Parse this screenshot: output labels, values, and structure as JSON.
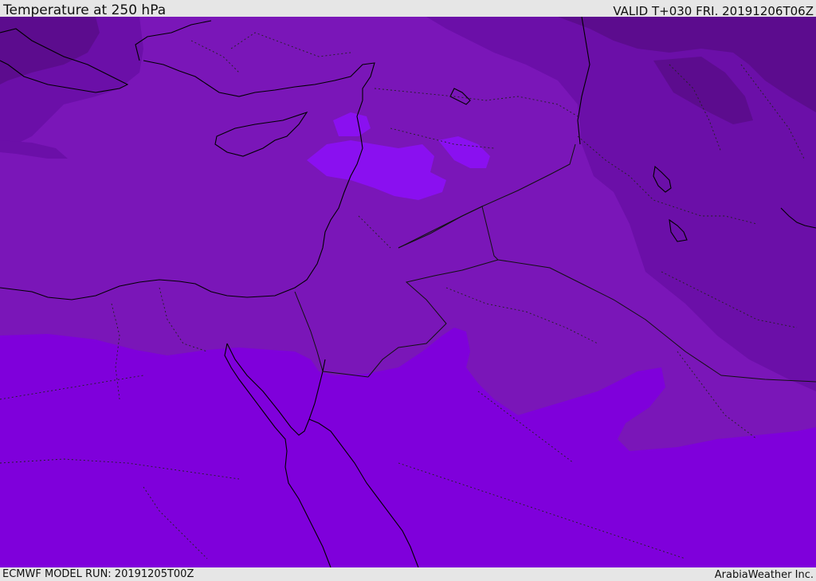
{
  "header": {
    "title": "Temperature at 250 hPa",
    "valid_time": "VALID T+030 FRI. 20191206T06Z"
  },
  "footer": {
    "model_run": "ECMWF MODEL RUN: 20191205T00Z",
    "credit": "ArabiaWeather Inc."
  },
  "map": {
    "field": "temperature",
    "level_hpa": 250,
    "colors": {
      "coldest_zone": "#5c0c8e",
      "cold_zone": "#6b0fa8",
      "mid_zone": "#7a16b8",
      "warm_zone": "#7f00db",
      "warmest_patch": "#8a10f0",
      "coastline": "#000000",
      "border": "#111111"
    }
  }
}
